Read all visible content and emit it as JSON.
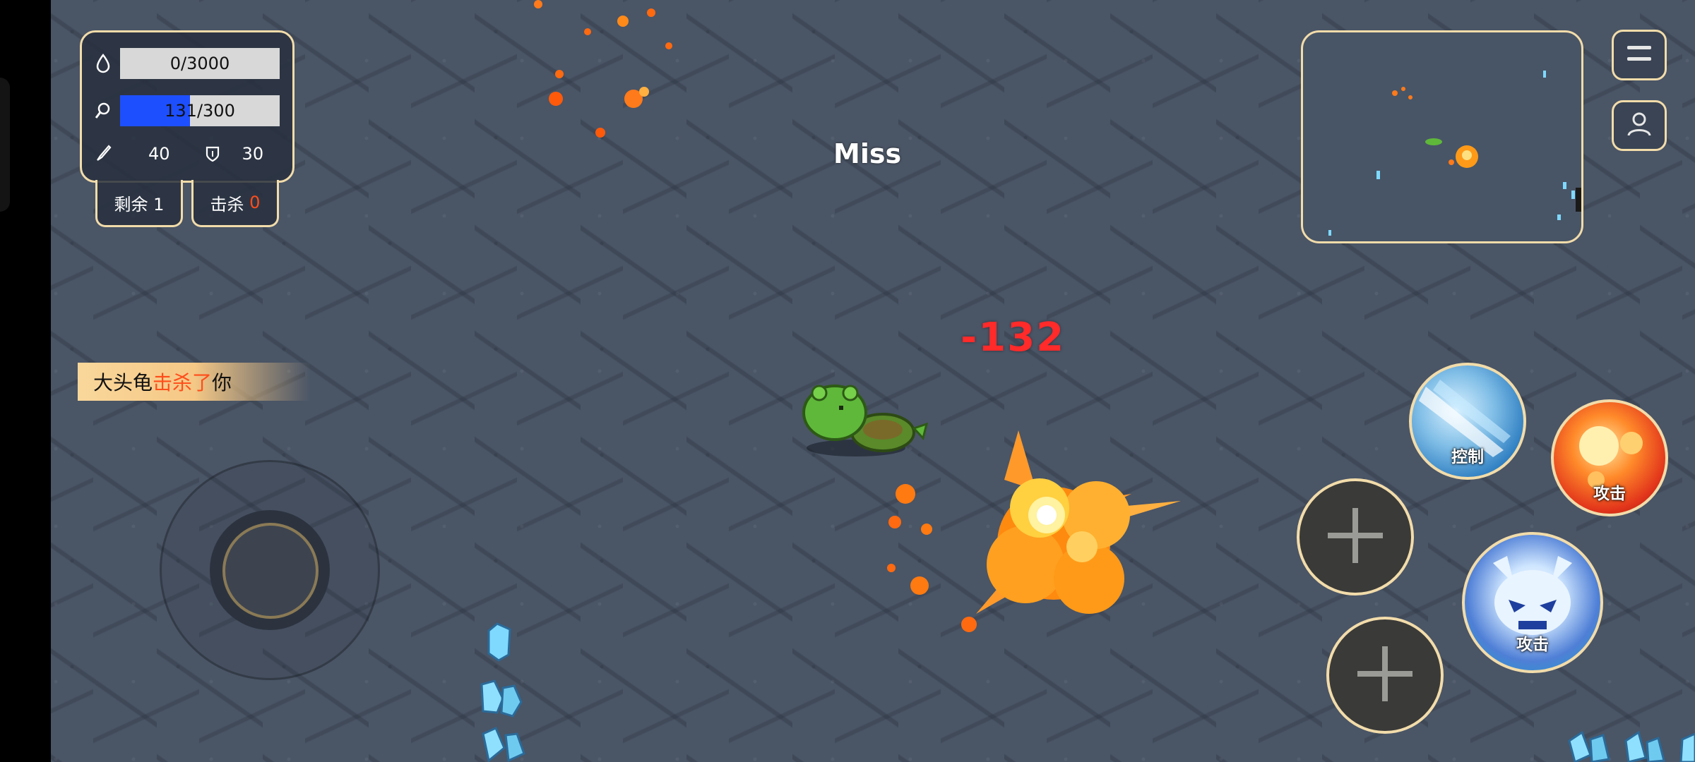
{
  "hud": {
    "hp": {
      "text": "0/3000",
      "fraction": 0.0
    },
    "mana": {
      "text": "131/300",
      "fraction": 0.4367
    },
    "attack": "40",
    "defense": "30",
    "remaining_label": "剩余 1",
    "kills_label": "击杀",
    "kills_value": "0"
  },
  "kill_feed": {
    "killer": "大头龟",
    "verb": "击杀了",
    "victim": "你"
  },
  "combat_text": {
    "miss": "Miss",
    "damage": "-132"
  },
  "skills": {
    "control": "控制",
    "attack_fire": "攻击",
    "attack_ice": "攻击"
  },
  "colors": {
    "panel_border": "#f2dcaa",
    "mana_fill": "#1e4fff",
    "damage": "#ff2a2a",
    "kill_accent": "#ff4d1a"
  },
  "icons": [
    "drop-icon",
    "magnifier-icon",
    "sword-icon",
    "shield-icon",
    "menu-icon",
    "user-icon",
    "plus-icon"
  ]
}
